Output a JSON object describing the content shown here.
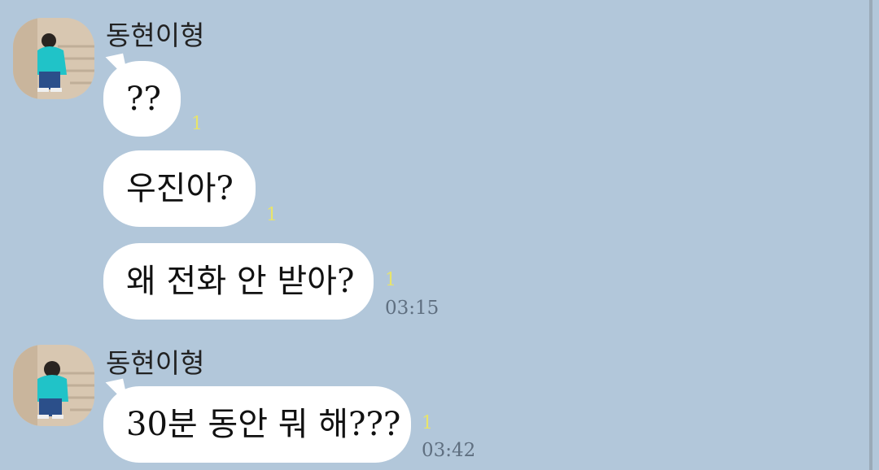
{
  "groups": [
    {
      "sender": "동현이형",
      "messages": [
        {
          "text": "??",
          "unread": "1",
          "time": ""
        },
        {
          "text": "우진아?",
          "unread": "1",
          "time": ""
        },
        {
          "text": "왜 전화 안 받아?",
          "unread": "1",
          "time": "03:15"
        }
      ]
    },
    {
      "sender": "동현이형",
      "messages": [
        {
          "text": "30분 동안 뭐 해???",
          "unread": "1",
          "time": "03:42"
        }
      ]
    }
  ],
  "colors": {
    "background": "#b2c7da",
    "bubble": "#ffffff",
    "unread": "#e8e46a",
    "timestamp": "#5f6f80"
  }
}
